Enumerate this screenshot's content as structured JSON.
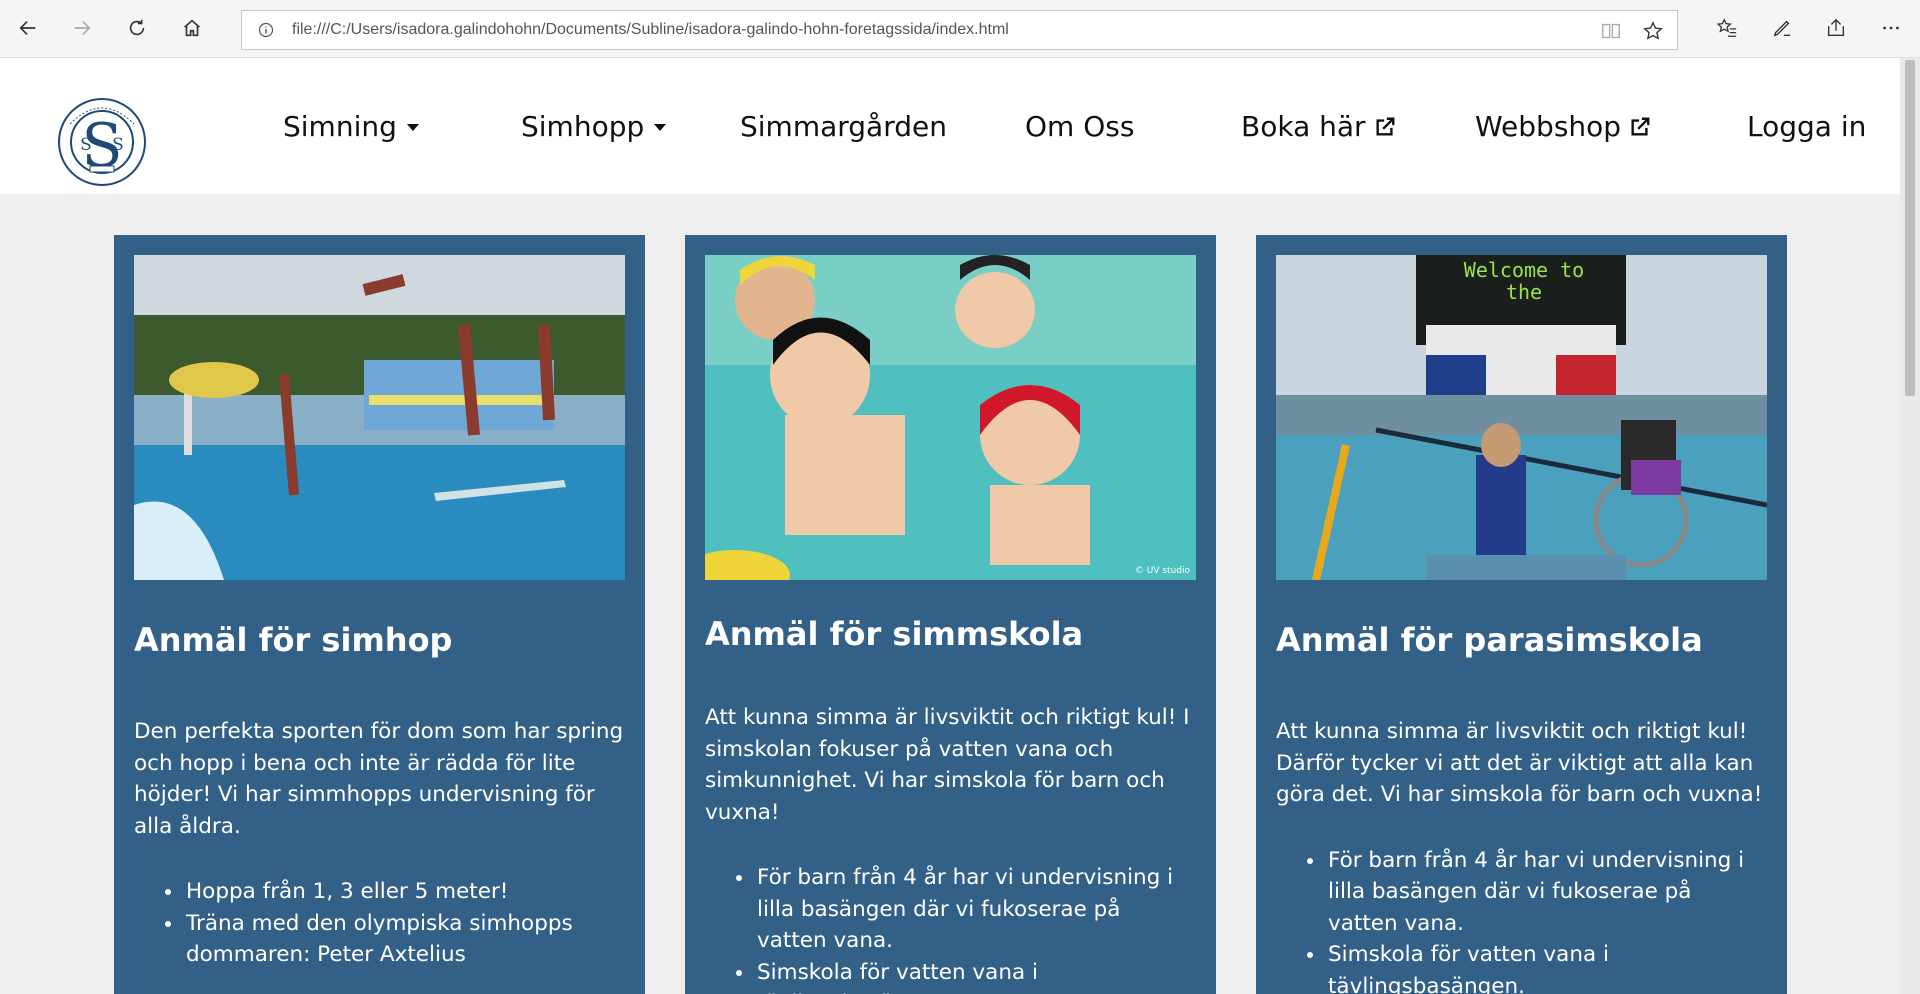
{
  "browser": {
    "url": "file:///C:/Users/isadora.galindohohn/Documents/Subline/isadora-galindo-hohn-foretagssida/index.html"
  },
  "site": {
    "logo_alt": "Södertälje Simsällskap",
    "menu": [
      {
        "label": "Simning",
        "icon": "caret-down-icon"
      },
      {
        "label": "Simhopp",
        "icon": "caret-down-icon"
      },
      {
        "label": "Simmargården"
      },
      {
        "label": "Om Oss"
      },
      {
        "label": "Boka här",
        "icon": "external-link-icon"
      },
      {
        "label": "Webbshop",
        "icon": "external-link-icon"
      },
      {
        "label": "Logga in"
      }
    ]
  },
  "cards": [
    {
      "title": "Anmäl för simhop",
      "description": "Den perfekta sporten för dom som har spring och hopp i bena och inte är rädda för lite höjder! Vi har simmhopps undervisning för alla åldra.",
      "bullets": [
        "Hoppa från 1, 3 eller 5 meter!",
        "Träna med den olympiska simhopps dommaren: Peter Axtelius"
      ]
    },
    {
      "title": "Anmäl för simmskola",
      "description": "Att kunna simma är livsviktit och riktigt kul! I simskolan fokuser på vatten vana och simkunnighet. Vi har simskola för barn och vuxna!",
      "bullets": [
        "För barn från 4 år har vi undervisning i lilla basängen där vi fukoserae på vatten vana.",
        "Simskola för vatten vana i tävlingsbasängen."
      ],
      "image_caption": "© UV studio"
    },
    {
      "title": "Anmäl för parasimskola",
      "description": "Att kunna simma är livsviktit och riktigt kul! Därför tycker vi att det är viktigt att alla kan göra det. Vi har simskola för barn och vuxna!",
      "bullets": [
        "För barn från 4 år har vi undervisning i lilla basängen där vi fukoserae på vatten vana.",
        "Simskola för vatten vana i tävlingsbasängen."
      ],
      "image_sign": "Welcome to the"
    }
  ]
}
